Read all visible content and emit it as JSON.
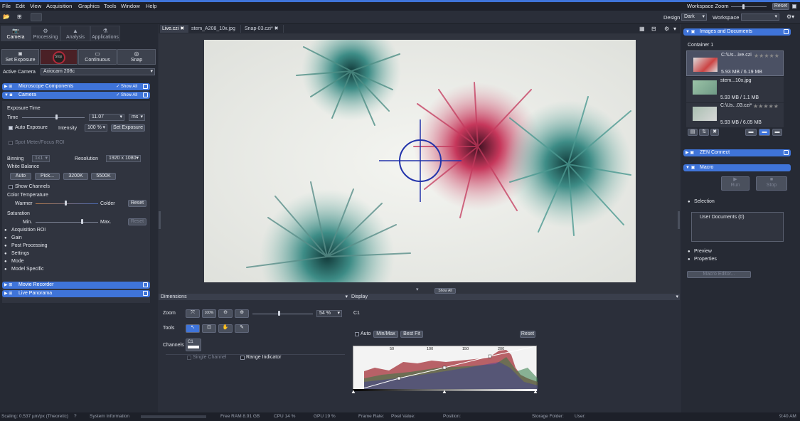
{
  "menubar": {
    "items": [
      "File",
      "Edit",
      "View",
      "Acquisition",
      "Graphics",
      "Tools",
      "Window",
      "Help"
    ],
    "workspace_zoom_label": "Workspace Zoom",
    "reset_label": "Reset"
  },
  "toolbar": {
    "design_label": "Design",
    "design_value": "Dark",
    "workspace_label": "Workspace"
  },
  "left_tabs": [
    {
      "label": "Camera"
    },
    {
      "label": "Processing"
    },
    {
      "label": "Analysis"
    },
    {
      "label": "Applications"
    }
  ],
  "camera_buttons": [
    {
      "label": "Set Exposure"
    },
    {
      "label": "Stop"
    },
    {
      "label": "Continuous"
    },
    {
      "label": "Snap"
    }
  ],
  "active_camera": {
    "label": "Active Camera",
    "value": "Axiocam 208c"
  },
  "sections": {
    "microscope": "Microscope Components",
    "camera": "Camera",
    "movie": "Movie Recorder",
    "panorama": "Live Panorama",
    "show_all": "Show All"
  },
  "camera": {
    "exposure_time_label": "Exposure Time",
    "time_label": "Time",
    "time_value": "11.07",
    "time_unit": "ms",
    "auto_exposure": "Auto Exposure",
    "intensity_label": "Intensity",
    "intensity_value": "100 %",
    "set_exposure": "Set Exposure",
    "spot_meter": "Spot Meter/Focus ROI",
    "binning_label": "Binning",
    "binning_value": "1x1",
    "resolution_label": "Resolution",
    "resolution_value": "1920 x 1080",
    "white_balance_label": "White Balance",
    "wb_buttons": [
      "Auto",
      "Pick...",
      "3200K",
      "5500K"
    ],
    "show_channels": "Show Channels",
    "color_temp_label": "Color Temperature",
    "warmer": "Warmer",
    "colder": "Colder",
    "reset": "Reset",
    "saturation_label": "Saturation",
    "min": "Min.",
    "max": "Max.",
    "groups": [
      "Acquisition ROI",
      "Gain",
      "Post Processing",
      "Settings",
      "Mode",
      "Model Specific"
    ]
  },
  "doc_tabs": [
    "Live.czi",
    "stem_A208_10x.jpg",
    "Snap-03.czi*"
  ],
  "show_all_handle": "Show All",
  "dimensions": {
    "title": "Dimensions",
    "zoom_label": "Zoom",
    "zoom_value": "54 %",
    "tools_label": "Tools",
    "channels_label": "Channels",
    "channel_name": "C1",
    "single_channel": "Single Channel",
    "range_indicator": "Range Indicator"
  },
  "display": {
    "title": "Display",
    "channel": "C1",
    "auto": "Auto",
    "minmax": "Min/Max",
    "bestfit": "Best Fit",
    "reset": "Reset",
    "ticks": [
      "50",
      "100",
      "150",
      "200"
    ]
  },
  "right": {
    "images_title": "Images and Documents",
    "container": "Container 1",
    "images": [
      {
        "name": "C:\\Us...ive.czi",
        "size": "5.93 MB / 6.19 MB"
      },
      {
        "name": "stem...10x.jpg",
        "size": "5.93 MB / 1.1 MB"
      },
      {
        "name": "C:\\Us...03.czi*",
        "size": "5.93 MB / 6.05 MB"
      }
    ],
    "zen_connect": "ZEN Connect",
    "macro": "Macro",
    "run": "Run",
    "stop": "Stop",
    "selection": "Selection",
    "user_documents": "User Documents (0)",
    "preview": "Preview",
    "properties": "Properties",
    "macro_editor": "Macro Editor..."
  },
  "status": {
    "scaling": "Scaling: 0.537 µm/px (Theoretic)",
    "system_info": "System Information",
    "free_ram": "Free RAM 8.91 GB",
    "cpu": "CPU 14 %",
    "gpu": "GPU 19 %",
    "frame_rate": "Frame Rate:",
    "pixel_value": "Pixel Value:",
    "position": "Position:",
    "storage": "Storage Folder:",
    "user": "User:",
    "time": "9:40 AM"
  },
  "colors": {
    "accent": "#3f74d9",
    "crosshair": "#2233aa"
  }
}
